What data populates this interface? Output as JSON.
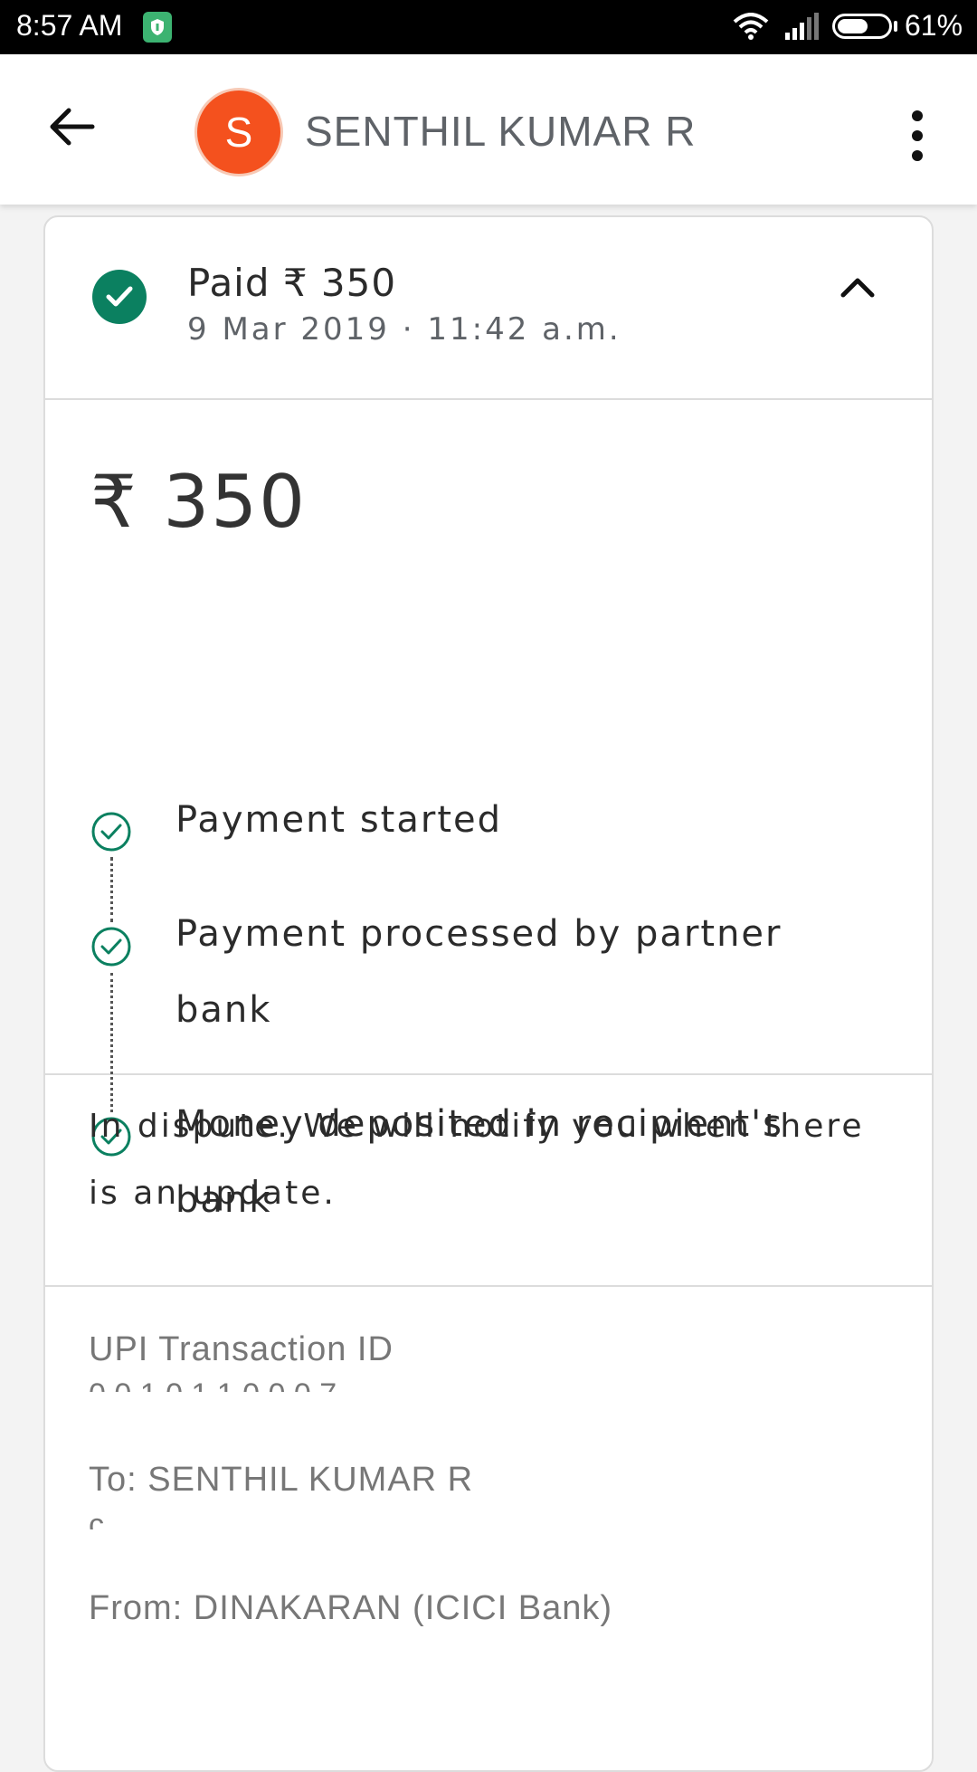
{
  "status_bar": {
    "time": "8:57 AM",
    "battery_text": "61%",
    "battery_level": 0.61,
    "icons": [
      "shield-icon",
      "wifi-icon",
      "signal-icon",
      "battery-icon"
    ]
  },
  "header": {
    "avatar_letter": "S",
    "contact_name": "SENTHIL KUMAR R",
    "icons": [
      "back-arrow-icon",
      "more-vert-icon"
    ]
  },
  "summary": {
    "title": "Paid ₹ 350",
    "date": "9 Mar 2019 · 11:42 a.m.",
    "icons": [
      "check-circle-icon",
      "chevron-up-icon"
    ]
  },
  "details": {
    "amount": "₹ 350",
    "steps": [
      {
        "label": "Payment started"
      },
      {
        "label": "Payment processed by partner bank"
      },
      {
        "label": "Money deposited in recipient's bank"
      }
    ]
  },
  "dispute": {
    "message": "In dispute. We will notify you when there is an update."
  },
  "info": {
    "upi_label": "UPI Transaction ID",
    "to_label": "To: SENTHIL KUMAR R",
    "from_label": "From: DINAKARAN (ICICI Bank)"
  },
  "colors": {
    "accent_green": "#0b8060",
    "avatar_orange": "#f4511e"
  }
}
